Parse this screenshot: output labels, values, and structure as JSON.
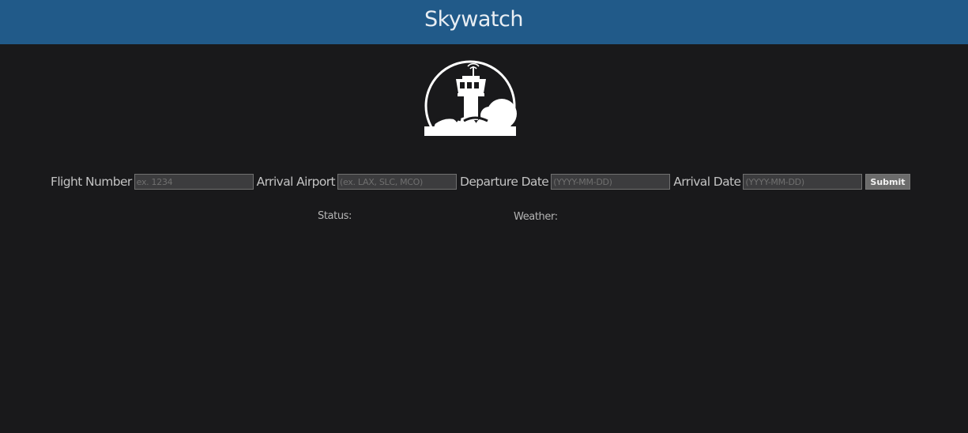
{
  "header": {
    "title": "Skywatch"
  },
  "logo": {
    "icon": "control-tower-icon"
  },
  "form": {
    "flight_number": {
      "label": "Flight Number",
      "placeholder": "ex. 1234",
      "value": ""
    },
    "arrival_airport": {
      "label": "Arrival Airport",
      "placeholder": "(ex. LAX, SLC, MCO)",
      "value": ""
    },
    "departure_date": {
      "label": "Departure Date",
      "placeholder": "(YYYY-MM-DD)",
      "value": ""
    },
    "arrival_date": {
      "label": "Arrival Date",
      "placeholder": "(YYYY-MM-DD)",
      "value": ""
    },
    "submit_label": "Submit"
  },
  "results": {
    "status_label": "Status:",
    "weather_label": "Weather:"
  },
  "colors": {
    "header_bg": "#215a89",
    "page_bg": "#19191b"
  }
}
